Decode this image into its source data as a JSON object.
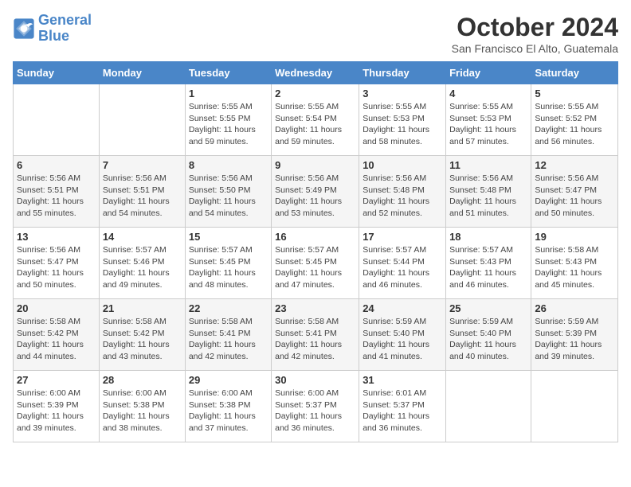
{
  "header": {
    "logo_line1": "General",
    "logo_line2": "Blue",
    "month": "October 2024",
    "location": "San Francisco El Alto, Guatemala"
  },
  "weekdays": [
    "Sunday",
    "Monday",
    "Tuesday",
    "Wednesday",
    "Thursday",
    "Friday",
    "Saturday"
  ],
  "weeks": [
    [
      {
        "day": "",
        "detail": ""
      },
      {
        "day": "",
        "detail": ""
      },
      {
        "day": "1",
        "detail": "Sunrise: 5:55 AM\nSunset: 5:55 PM\nDaylight: 11 hours and 59 minutes."
      },
      {
        "day": "2",
        "detail": "Sunrise: 5:55 AM\nSunset: 5:54 PM\nDaylight: 11 hours and 59 minutes."
      },
      {
        "day": "3",
        "detail": "Sunrise: 5:55 AM\nSunset: 5:53 PM\nDaylight: 11 hours and 58 minutes."
      },
      {
        "day": "4",
        "detail": "Sunrise: 5:55 AM\nSunset: 5:53 PM\nDaylight: 11 hours and 57 minutes."
      },
      {
        "day": "5",
        "detail": "Sunrise: 5:55 AM\nSunset: 5:52 PM\nDaylight: 11 hours and 56 minutes."
      }
    ],
    [
      {
        "day": "6",
        "detail": "Sunrise: 5:56 AM\nSunset: 5:51 PM\nDaylight: 11 hours and 55 minutes."
      },
      {
        "day": "7",
        "detail": "Sunrise: 5:56 AM\nSunset: 5:51 PM\nDaylight: 11 hours and 54 minutes."
      },
      {
        "day": "8",
        "detail": "Sunrise: 5:56 AM\nSunset: 5:50 PM\nDaylight: 11 hours and 54 minutes."
      },
      {
        "day": "9",
        "detail": "Sunrise: 5:56 AM\nSunset: 5:49 PM\nDaylight: 11 hours and 53 minutes."
      },
      {
        "day": "10",
        "detail": "Sunrise: 5:56 AM\nSunset: 5:48 PM\nDaylight: 11 hours and 52 minutes."
      },
      {
        "day": "11",
        "detail": "Sunrise: 5:56 AM\nSunset: 5:48 PM\nDaylight: 11 hours and 51 minutes."
      },
      {
        "day": "12",
        "detail": "Sunrise: 5:56 AM\nSunset: 5:47 PM\nDaylight: 11 hours and 50 minutes."
      }
    ],
    [
      {
        "day": "13",
        "detail": "Sunrise: 5:56 AM\nSunset: 5:47 PM\nDaylight: 11 hours and 50 minutes."
      },
      {
        "day": "14",
        "detail": "Sunrise: 5:57 AM\nSunset: 5:46 PM\nDaylight: 11 hours and 49 minutes."
      },
      {
        "day": "15",
        "detail": "Sunrise: 5:57 AM\nSunset: 5:45 PM\nDaylight: 11 hours and 48 minutes."
      },
      {
        "day": "16",
        "detail": "Sunrise: 5:57 AM\nSunset: 5:45 PM\nDaylight: 11 hours and 47 minutes."
      },
      {
        "day": "17",
        "detail": "Sunrise: 5:57 AM\nSunset: 5:44 PM\nDaylight: 11 hours and 46 minutes."
      },
      {
        "day": "18",
        "detail": "Sunrise: 5:57 AM\nSunset: 5:43 PM\nDaylight: 11 hours and 46 minutes."
      },
      {
        "day": "19",
        "detail": "Sunrise: 5:58 AM\nSunset: 5:43 PM\nDaylight: 11 hours and 45 minutes."
      }
    ],
    [
      {
        "day": "20",
        "detail": "Sunrise: 5:58 AM\nSunset: 5:42 PM\nDaylight: 11 hours and 44 minutes."
      },
      {
        "day": "21",
        "detail": "Sunrise: 5:58 AM\nSunset: 5:42 PM\nDaylight: 11 hours and 43 minutes."
      },
      {
        "day": "22",
        "detail": "Sunrise: 5:58 AM\nSunset: 5:41 PM\nDaylight: 11 hours and 42 minutes."
      },
      {
        "day": "23",
        "detail": "Sunrise: 5:58 AM\nSunset: 5:41 PM\nDaylight: 11 hours and 42 minutes."
      },
      {
        "day": "24",
        "detail": "Sunrise: 5:59 AM\nSunset: 5:40 PM\nDaylight: 11 hours and 41 minutes."
      },
      {
        "day": "25",
        "detail": "Sunrise: 5:59 AM\nSunset: 5:40 PM\nDaylight: 11 hours and 40 minutes."
      },
      {
        "day": "26",
        "detail": "Sunrise: 5:59 AM\nSunset: 5:39 PM\nDaylight: 11 hours and 39 minutes."
      }
    ],
    [
      {
        "day": "27",
        "detail": "Sunrise: 6:00 AM\nSunset: 5:39 PM\nDaylight: 11 hours and 39 minutes."
      },
      {
        "day": "28",
        "detail": "Sunrise: 6:00 AM\nSunset: 5:38 PM\nDaylight: 11 hours and 38 minutes."
      },
      {
        "day": "29",
        "detail": "Sunrise: 6:00 AM\nSunset: 5:38 PM\nDaylight: 11 hours and 37 minutes."
      },
      {
        "day": "30",
        "detail": "Sunrise: 6:00 AM\nSunset: 5:37 PM\nDaylight: 11 hours and 36 minutes."
      },
      {
        "day": "31",
        "detail": "Sunrise: 6:01 AM\nSunset: 5:37 PM\nDaylight: 11 hours and 36 minutes."
      },
      {
        "day": "",
        "detail": ""
      },
      {
        "day": "",
        "detail": ""
      }
    ]
  ]
}
